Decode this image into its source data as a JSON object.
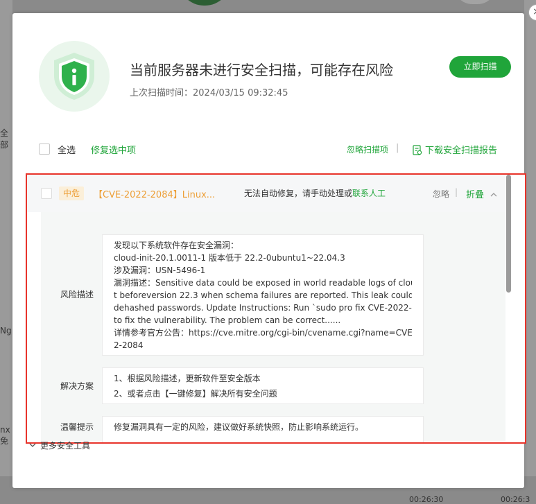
{
  "background": {
    "left_fragments": [
      "全部",
      "Ng",
      "nx免"
    ],
    "bottom_times": [
      "00:26:30",
      "00:26:3"
    ]
  },
  "dialog": {
    "close_glyph": "×",
    "title": "当前服务器未进行安全扫描，可能存在风险",
    "last_scan_label": "上次扫描时间：",
    "last_scan_time": "2024/03/15 09:32:45",
    "scan_button": "立即扫描",
    "toolbar": {
      "select_all": "全选",
      "fix_selected": "修复选中项",
      "ignored_scans": "忽略扫描项",
      "separator": "|",
      "download_report": "下载安全扫描报告"
    },
    "item": {
      "risk_level": "中危",
      "title": "【CVE-2022-2084】Linux...",
      "manual_text": "无法自动修复，请手动处理或",
      "contact_link": "联系人工",
      "ignore": "忽略",
      "separator": "|",
      "collapse": "折叠",
      "risk_desc_label": "风险描述",
      "risk_desc_lines": [
        "发现以下系统软件存在安全漏洞：",
        "cloud-init-20.1.0011-1 版本低于 22.2-0ubuntu1~22.04.3",
        "涉及漏洞：USN-5496-1",
        "漏洞描述：Sensitive data could be exposed in world readable logs of cloud-init",
        "t beforeversion 22.3 when schema failures are reported. This leak could inclu",
        "dehashed passwords. Update Instructions: Run `sudo pro fix CVE-2022-2084`",
        "to fix the vulnerability. The problem can be correct......",
        "详情参考官方公告：https://cve.mitre.org/cgi-bin/cvename.cgi?name=CVE-202",
        "2-2084"
      ],
      "solution_label": "解决方案",
      "solution_lines": [
        "1、根据风险描述，更新软件至安全版本",
        "2、或者点击【一键修复】解决所有安全问题"
      ],
      "tip_label": "温馨提示",
      "tip_text": "修复漏洞具有一定的风险，建议做好系统快照，防止影响系统运行。"
    },
    "more_tools": "更多安全工具"
  },
  "colors": {
    "accent_green": "#20a53a",
    "risk_orange": "#ed9f37",
    "highlight_red": "#e8342b"
  }
}
